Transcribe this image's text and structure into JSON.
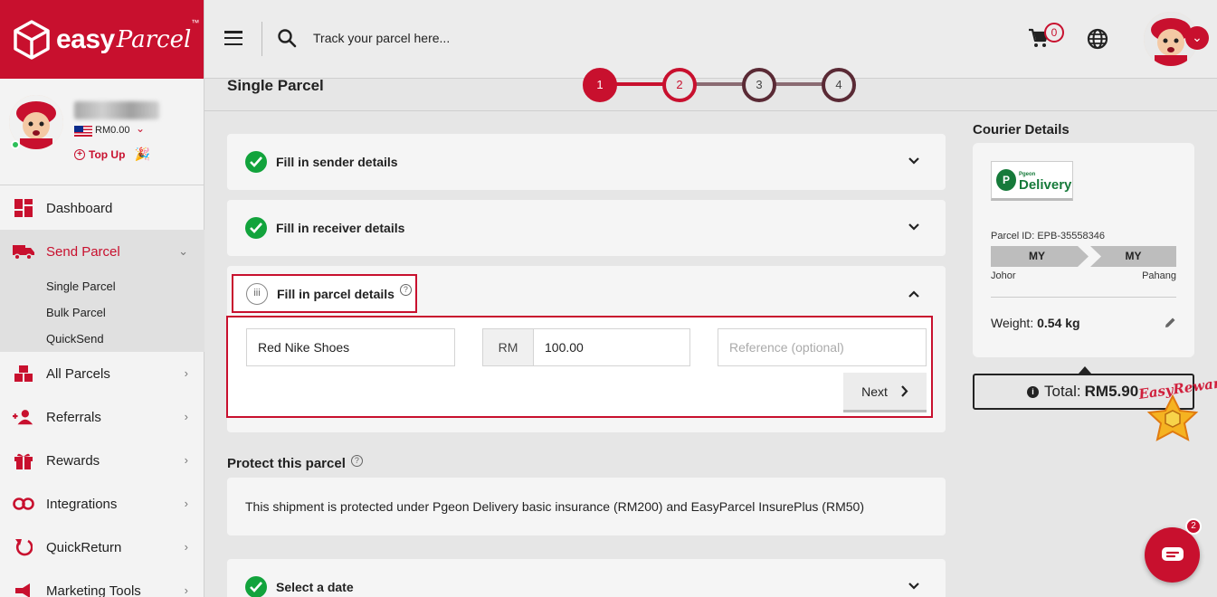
{
  "brand": {
    "word1": "easy",
    "word2": "Parcel",
    "tm": "™"
  },
  "profile": {
    "balance": "RM0.00",
    "topup_label": "Top Up"
  },
  "sidebar": {
    "items": [
      {
        "label": "Dashboard",
        "icon": "dashboard-icon"
      },
      {
        "label": "Send Parcel",
        "icon": "truck-icon"
      },
      {
        "label": "All Parcels",
        "icon": "parcels-icon"
      },
      {
        "label": "Referrals",
        "icon": "referrals-icon"
      },
      {
        "label": "Rewards",
        "icon": "gift-icon"
      },
      {
        "label": "Integrations",
        "icon": "link-icon"
      },
      {
        "label": "QuickReturn",
        "icon": "return-icon"
      },
      {
        "label": "Marketing Tools",
        "icon": "megaphone-icon"
      }
    ],
    "send_parcel_sub": [
      "Single Parcel",
      "Bulk Parcel",
      "QuickSend"
    ]
  },
  "topbar": {
    "search_placeholder": "Track your parcel here...",
    "cart_count": "0"
  },
  "page": {
    "title": "Single Parcel",
    "steps": [
      "1",
      "2",
      "3",
      "4"
    ]
  },
  "accordion": {
    "sender": "Fill in sender details",
    "receiver": "Fill in receiver details",
    "parcel": "Fill in parcel details",
    "parcel_step": "iii",
    "date": "Select a date"
  },
  "parcel_form": {
    "content_value": "Red Nike Shoes",
    "currency": "RM",
    "value": "100.00",
    "reference_placeholder": "Reference (optional)",
    "next_label": "Next"
  },
  "protect": {
    "title": "Protect this parcel",
    "text": "This shipment is protected under Pgeon Delivery basic insurance (RM200) and EasyParcel InsurePlus (RM50)"
  },
  "courier": {
    "title": "Courier Details",
    "logo_small": "Pgeon",
    "logo_main": "Delivery",
    "parcel_id": "Parcel ID: EPB-35558346",
    "from_country": "MY",
    "to_country": "MY",
    "from_state": "Johor",
    "to_state": "Pahang",
    "weight_label": "Weight:",
    "weight_value": "0.54 kg"
  },
  "total": {
    "label": "Total:",
    "value": "RM5.90"
  },
  "reward_text": "EasyReward",
  "chat_badge": "2",
  "colors": {
    "brand_red": "#c8102e",
    "check_green": "#12a33c",
    "courier_green": "#167a3a"
  }
}
